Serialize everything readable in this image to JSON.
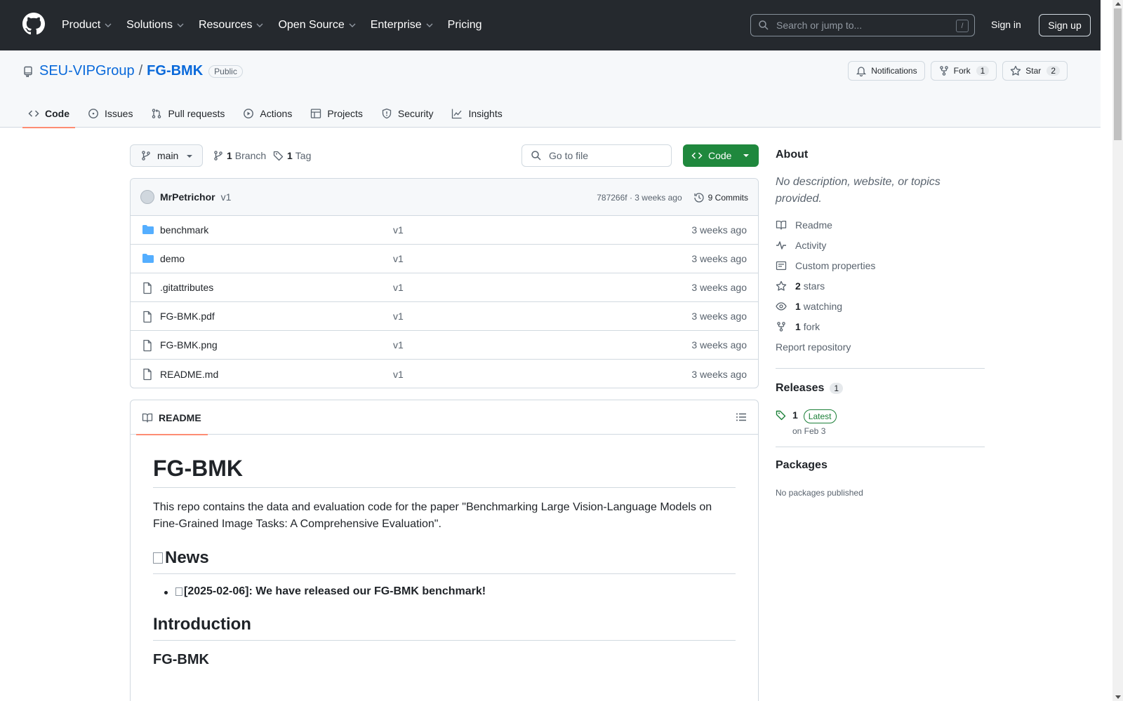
{
  "header": {
    "nav": [
      "Product",
      "Solutions",
      "Resources",
      "Open Source",
      "Enterprise",
      "Pricing"
    ],
    "search_placeholder": "Search or jump to...",
    "search_shortcut": "/",
    "sign_in": "Sign in",
    "sign_up": "Sign up"
  },
  "repo": {
    "owner": "SEU-VIPGroup",
    "separator": "/",
    "name": "FG-BMK",
    "visibility": "Public",
    "notifications_label": "Notifications",
    "fork_label": "Fork",
    "fork_count": "1",
    "star_label": "Star",
    "star_count": "2"
  },
  "tabs": [
    {
      "label": "Code",
      "icon": "code-icon",
      "active": true
    },
    {
      "label": "Issues",
      "icon": "issue-icon"
    },
    {
      "label": "Pull requests",
      "icon": "pull-request-icon"
    },
    {
      "label": "Actions",
      "icon": "play-icon"
    },
    {
      "label": "Projects",
      "icon": "table-icon"
    },
    {
      "label": "Security",
      "icon": "shield-icon"
    },
    {
      "label": "Insights",
      "icon": "graph-icon"
    }
  ],
  "toolbar": {
    "branch": "main",
    "branch_count": "1",
    "branch_label": "Branch",
    "tag_count": "1",
    "tag_label": "Tag",
    "goto_placeholder": "Go to file",
    "code_button": "Code"
  },
  "commit": {
    "author": "MrPetrichor",
    "message": "v1",
    "hash_time": "787266f · 3 weeks ago",
    "commits": "9 Commits"
  },
  "files": [
    {
      "name": "benchmark",
      "type": "folder",
      "message": "v1",
      "date": "3 weeks ago"
    },
    {
      "name": "demo",
      "type": "folder",
      "message": "v1",
      "date": "3 weeks ago"
    },
    {
      "name": ".gitattributes",
      "type": "file",
      "message": "v1",
      "date": "3 weeks ago"
    },
    {
      "name": "FG-BMK.pdf",
      "type": "file",
      "message": "v1",
      "date": "3 weeks ago"
    },
    {
      "name": "FG-BMK.png",
      "type": "file",
      "message": "v1",
      "date": "3 weeks ago"
    },
    {
      "name": "README.md",
      "type": "file",
      "message": "v1",
      "date": "3 weeks ago"
    }
  ],
  "readme": {
    "tab_label": "README",
    "h1": "FG-BMK",
    "intro": "This repo contains the data and evaluation code for the paper \"Benchmarking Large Vision-Language Models on Fine-Grained Image Tasks: A Comprehensive Evaluation\".",
    "news_heading": "News",
    "news_item": "[2025-02-06]: We have released our FG-BMK benchmark!",
    "intro_heading": "Introduction",
    "sub_heading": "FG-BMK"
  },
  "sidebar": {
    "about_title": "About",
    "about_desc": "No description, website, or topics provided.",
    "readme": "Readme",
    "activity": "Activity",
    "custom_properties": "Custom properties",
    "stars_count": "2",
    "stars_label": "stars",
    "watching_count": "1",
    "watching_label": "watching",
    "fork_count": "1",
    "fork_label": "fork",
    "report": "Report repository",
    "releases_title": "Releases",
    "releases_count": "1",
    "release_name": "1",
    "release_badge": "Latest",
    "release_date": "on Feb 3",
    "packages_title": "Packages",
    "packages_text": "No packages published"
  },
  "colors": {
    "header_bg": "#25292e",
    "link": "#0969da",
    "primary_button": "#1f883d",
    "tab_underline": "#fd8c73",
    "folder": "#54aeff"
  }
}
